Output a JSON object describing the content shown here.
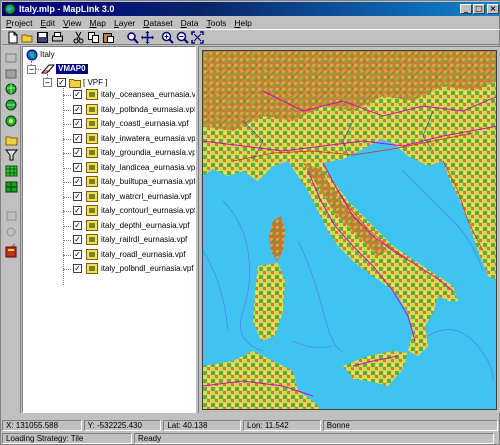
{
  "window": {
    "title": "Italy.mlp - MapLink 3.0",
    "controls": [
      "_",
      "□",
      "×"
    ]
  },
  "menu": [
    "Project",
    "Edit",
    "View",
    "Map",
    "Layer",
    "Dataset",
    "Data",
    "Tools",
    "Help"
  ],
  "toolbar_icons": [
    "new-icon",
    "open-icon",
    "save-icon",
    "print-icon",
    "cut-icon",
    "copy-icon",
    "paste-icon",
    "select-icon",
    "pan-icon",
    "zoom-in-icon",
    "zoom-out-icon",
    "zoom-extents-icon"
  ],
  "left_tools": [
    "new-layer-icon",
    "layer-icon",
    "globe-icon",
    "globe-icon",
    "globe-icon",
    "folder-icon",
    "filter-icon",
    "grid-icon",
    "grid-icon",
    "disabled-icon",
    "disabled-icon",
    "disabled-icon",
    "book-icon"
  ],
  "tree": {
    "root": "Italy",
    "source": "VMAP0",
    "folder": "[ VPF ]",
    "layers": [
      "italy_oceansea_eurnasia.vpf",
      "italy_polbnda_eurnasia.vpf",
      "italy_coastl_eurnasia.vpf",
      "italy_inwatera_eurnasia.vpf",
      "italy_groundia_eurnasia.vpf",
      "italy_landicea_eurnasia.vpf",
      "italy_builtupa_eurnasia.vpf",
      "italy_watrcrl_eurnasia.vpf",
      "italy_contourl_eurnasia.vpf",
      "italy_depthl_eurnasia.vpf",
      "italy_railrdl_eurnasia.vpf",
      "italy_roadl_eurnasia.vpf",
      "italy_polbndl_eurnasia.vpf"
    ]
  },
  "status": {
    "x": "X: 131055.588",
    "y": "Y: -532225.430",
    "lat": "Lat: 40.138",
    "lon": "Lon: 11.542",
    "units": "Bonne",
    "strategy": "Loading Strategy: Tile",
    "state": "Ready"
  },
  "colors": {
    "sea": "#3fc3f0",
    "land_low": "#e8e060",
    "land_green": "#58b040",
    "mountain": "#c87830",
    "road": "#e000c0",
    "title_bar": "#000080"
  }
}
